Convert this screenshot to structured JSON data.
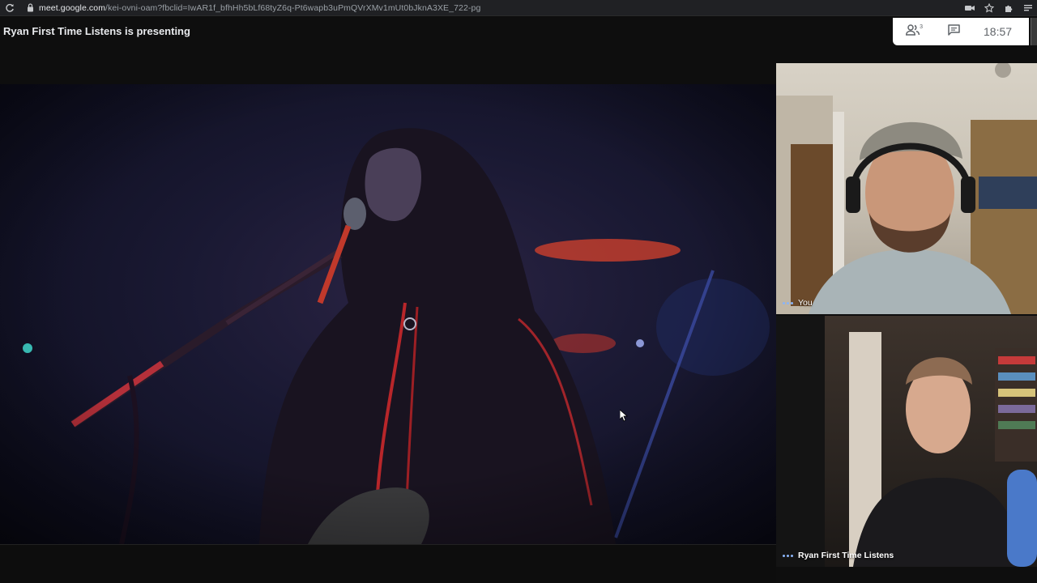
{
  "browser": {
    "url_host": "meet.google.com",
    "url_path": "/kei-ovni-oam?fbclid=IwAR1f_bfhHh5bLf68tyZ6q-Pt6wapb3uPmQVrXMv1mUt0bJknA3XE_722-pg"
  },
  "meeting": {
    "presenting_text": "Ryan First Time Listens is presenting",
    "people_count": "3",
    "time": "18:57"
  },
  "tiles": [
    {
      "label": "You"
    },
    {
      "label": "Ryan First Time Listens"
    }
  ],
  "icons": {
    "reload": "reload-icon",
    "lock": "lock-icon",
    "people": "people-icon",
    "chat": "chat-icon"
  },
  "colors": {
    "panel_bg": "#ffffff",
    "speaking_dots": "#8ab4f8"
  }
}
